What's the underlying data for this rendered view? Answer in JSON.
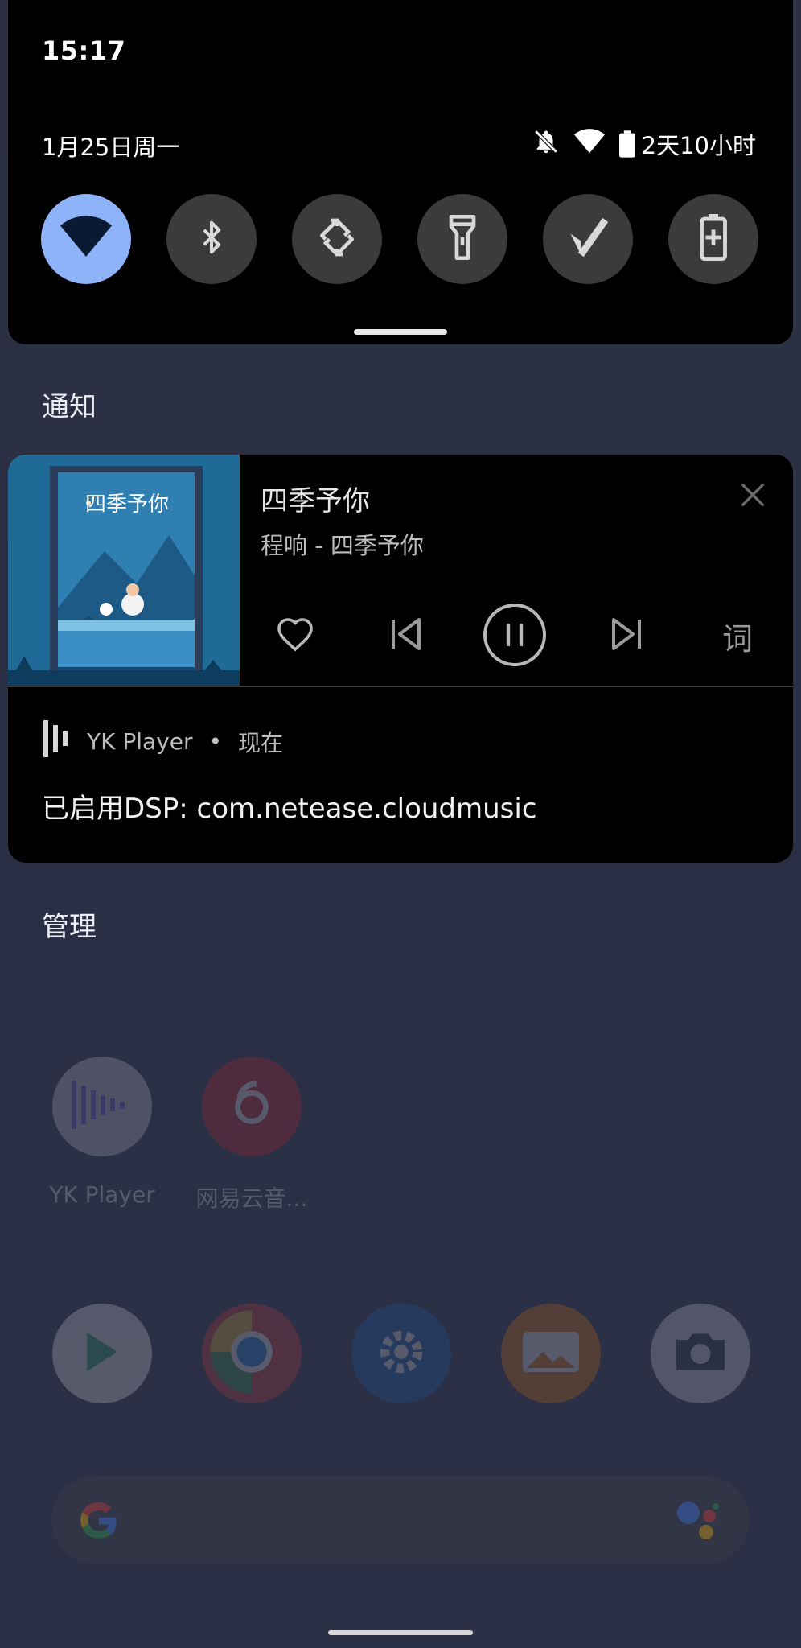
{
  "status_bar": {
    "time": "15:17",
    "date": "1月25日周一",
    "battery_text": "2天10小时"
  },
  "quick_settings": {
    "tiles": [
      {
        "icon": "wifi-icon",
        "active": true
      },
      {
        "icon": "bluetooth-icon",
        "active": false
      },
      {
        "icon": "auto-rotate-icon",
        "active": false
      },
      {
        "icon": "flashlight-icon",
        "active": false
      },
      {
        "icon": "mobile-data-icon",
        "active": false
      },
      {
        "icon": "battery-saver-icon",
        "active": false
      }
    ]
  },
  "notifications_header": "通知",
  "media_notification": {
    "title": "四季予你",
    "subtitle": "程响 - 四季予你",
    "art_text": "四季予你",
    "lyric_button": "词",
    "app_name": "YK Player",
    "separator": "•",
    "time": "现在",
    "message": "已启用DSP: com.netease.cloudmusic"
  },
  "manage_button": "管理",
  "home_screen": {
    "apps": [
      {
        "label": "YK Player",
        "icon": "yk-player-icon"
      },
      {
        "label": "网易云音...",
        "icon": "netease-music-icon"
      }
    ],
    "dock": [
      {
        "icon": "play-store-icon"
      },
      {
        "icon": "chrome-icon"
      },
      {
        "icon": "settings-icon"
      },
      {
        "icon": "gallery-icon"
      },
      {
        "icon": "camera-icon"
      }
    ]
  },
  "colors": {
    "accent": "#8fb3f8",
    "panel": "#000000",
    "tile": "#3b3b3e",
    "background": "#2b3046"
  }
}
